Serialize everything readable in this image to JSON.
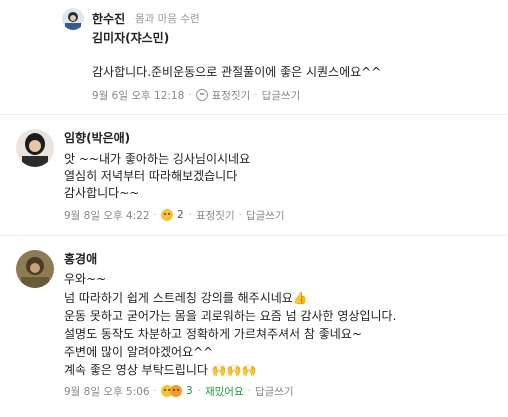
{
  "comments": [
    {
      "author": "한수진",
      "badge": "몸과 마음 수련",
      "mention": "김미자(쟈스민)",
      "lines": [
        "감사합니다.준비운동으로 관절풀이에 좋은 시퀀스에요^^"
      ],
      "time": "9월 6일 오후 12:18",
      "emote_label": "표정짓기",
      "reply_label": "답글쓰기"
    },
    {
      "author": "임향(박은애)",
      "lines": [
        "앗 ~~내가 좋아하는 깅사님이시네요",
        "열심히 저녁부터  따라해보겠습니다",
        "감사합니다~~"
      ],
      "time": "9월 8일 오후 4:22",
      "reaction_count": "2",
      "emote_label": "표정짓기",
      "reply_label": "답글쓰기"
    },
    {
      "author": "홍경애",
      "lines": [
        "우와~~",
        "넘 따라하기 쉽게 스트레칭 강의를 해주시네요👍",
        "운동 못하고 굳어가는 몸을 괴로워하는 요즘 넘 감사한 영상입니다.",
        "설명도 동작도 차분하고 정확하게 가르쳐주셔서 참 좋네요~",
        "주변에 많이 알려야겠어요^^",
        "계속 좋은 영상 부탁드립니다 🙌🙌🙌"
      ],
      "time": "9월 8일 오후 5:06",
      "reaction_count": "3",
      "liked_label": "재밌어요",
      "reply_label": "답글쓰기"
    }
  ],
  "colors": {
    "like_green": "#1a9a3c"
  }
}
